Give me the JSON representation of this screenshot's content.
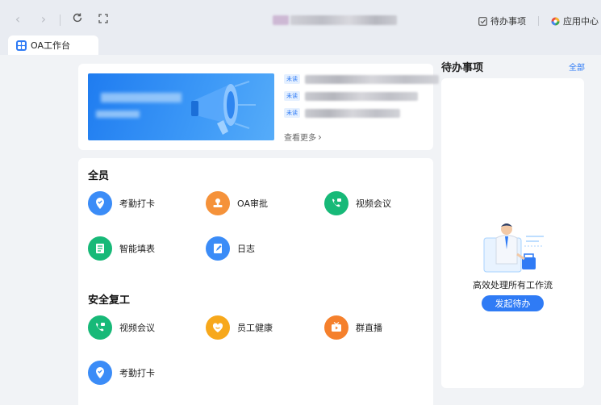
{
  "browser": {
    "todo_link": "待办事项",
    "app_center_link": "应用中心"
  },
  "tab": {
    "label": "OA工作台"
  },
  "notices": {
    "badge_label": "未读",
    "more_label": "查看更多"
  },
  "sections": [
    {
      "title": "全员",
      "apps": [
        {
          "label": "考勤打卡",
          "icon": "location-check-icon",
          "color": "#3b8cf7"
        },
        {
          "label": "OA审批",
          "icon": "stamp-icon",
          "color": "#f5923a"
        },
        {
          "label": "视频会议",
          "icon": "video-call-icon",
          "color": "#17b978"
        },
        {
          "label": "智能填表",
          "icon": "form-icon",
          "color": "#17b978"
        },
        {
          "label": "日志",
          "icon": "journal-icon",
          "color": "#3b8cf7"
        }
      ]
    },
    {
      "title": "安全复工",
      "apps": [
        {
          "label": "视频会议",
          "icon": "video-call-icon",
          "color": "#17b978"
        },
        {
          "label": "员工健康",
          "icon": "heart-icon",
          "color": "#f7a81b"
        },
        {
          "label": "群直播",
          "icon": "tv-live-icon",
          "color": "#f5802c"
        },
        {
          "label": "考勤打卡",
          "icon": "location-check-icon",
          "color": "#3b8cf7"
        }
      ]
    }
  ],
  "todo": {
    "title": "待办事项",
    "all_label": "全部",
    "empty_text": "高效处理所有工作流",
    "start_button": "发起待办"
  }
}
